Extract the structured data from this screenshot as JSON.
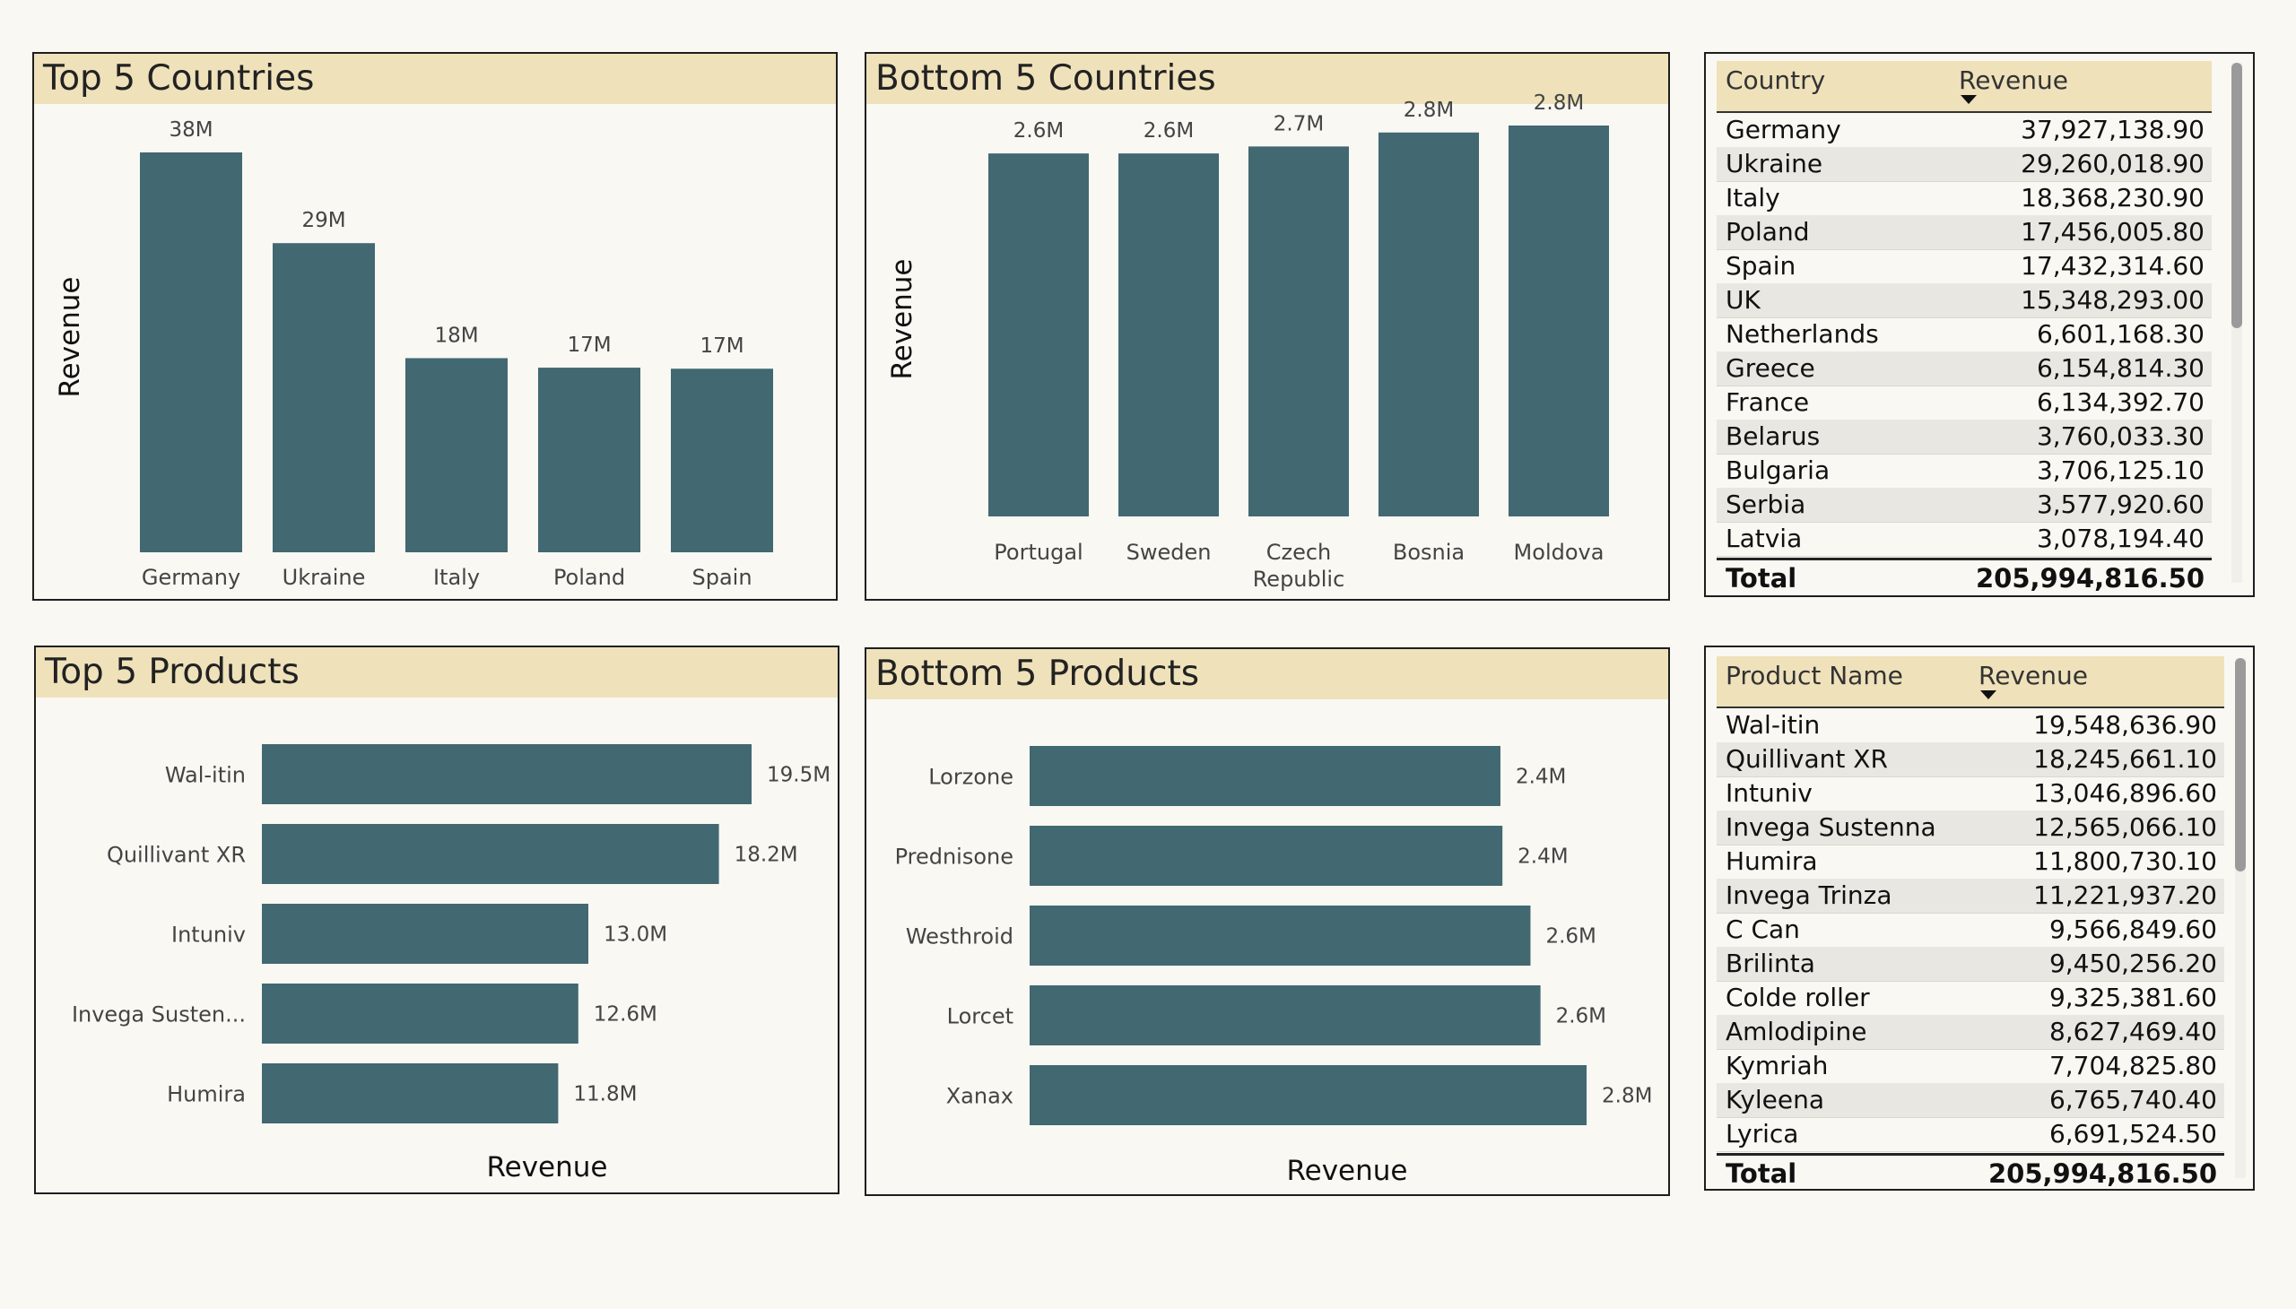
{
  "colors": {
    "bar": "#426872",
    "header_bg": "#efe1ba",
    "background": "#f9f8f3",
    "row_alt": "#e8e7e2"
  },
  "panels": {
    "top_countries_title": "Top 5 Countries",
    "bottom_countries_title": "Bottom 5 Countries",
    "top_products_title": "Top 5 Products",
    "bottom_products_title": "Bottom 5 Products"
  },
  "chart_data": [
    {
      "id": "top_countries",
      "type": "bar",
      "orientation": "vertical",
      "title": "Top 5 Countries",
      "ylabel": "Revenue",
      "xlabel": "",
      "categories": [
        "Germany",
        "Ukraine",
        "Italy",
        "Poland",
        "Spain"
      ],
      "values": [
        37.9,
        29.3,
        18.4,
        17.5,
        17.4
      ],
      "data_labels": [
        "38M",
        "29M",
        "18M",
        "17M",
        "17M"
      ],
      "units": "M",
      "ylim": [
        0,
        40
      ],
      "grid": false
    },
    {
      "id": "bottom_countries",
      "type": "bar",
      "orientation": "vertical",
      "title": "Bottom 5 Countries",
      "ylabel": "Revenue",
      "xlabel": "",
      "categories": [
        "Portugal",
        "Sweden",
        "Czech Republic",
        "Bosnia",
        "Moldova"
      ],
      "values": [
        2.6,
        2.6,
        2.65,
        2.75,
        2.8
      ],
      "data_labels": [
        "2.6M",
        "2.6M",
        "2.7M",
        "2.8M",
        "2.8M"
      ],
      "units": "M",
      "ylim": [
        0,
        3.0
      ],
      "grid": false
    },
    {
      "id": "top_products",
      "type": "bar",
      "orientation": "horizontal",
      "title": "Top 5 Products",
      "xlabel": "Revenue",
      "ylabel": "",
      "categories": [
        "Wal-itin",
        "Quillivant XR",
        "Intuniv",
        "Invega Susten...",
        "Humira"
      ],
      "values": [
        19.5,
        18.2,
        13.0,
        12.6,
        11.8
      ],
      "data_labels": [
        "19.5M",
        "18.2M",
        "13.0M",
        "12.6M",
        "11.8M"
      ],
      "units": "M",
      "xlim": [
        0,
        19.5
      ],
      "grid": false
    },
    {
      "id": "bottom_products",
      "type": "bar",
      "orientation": "horizontal",
      "title": "Bottom 5 Products",
      "xlabel": "Revenue",
      "ylabel": "",
      "categories": [
        "Lorzone",
        "Prednisone",
        "Westhroid",
        "Lorcet",
        "Xanax"
      ],
      "values": [
        2.35,
        2.36,
        2.5,
        2.55,
        2.78
      ],
      "data_labels": [
        "2.4M",
        "2.4M",
        "2.6M",
        "2.6M",
        "2.8M"
      ],
      "units": "M",
      "xlim": [
        0,
        2.78
      ],
      "grid": false
    }
  ],
  "country_table": {
    "headers": [
      "Country",
      "Revenue"
    ],
    "rows": [
      [
        "Germany",
        "37,927,138.90"
      ],
      [
        "Ukraine",
        "29,260,018.90"
      ],
      [
        "Italy",
        "18,368,230.90"
      ],
      [
        "Poland",
        "17,456,005.80"
      ],
      [
        "Spain",
        "17,432,314.60"
      ],
      [
        "UK",
        "15,348,293.00"
      ],
      [
        "Netherlands",
        "6,601,168.30"
      ],
      [
        "Greece",
        "6,154,814.30"
      ],
      [
        "France",
        "6,134,392.70"
      ],
      [
        "Belarus",
        "3,760,033.30"
      ],
      [
        "Bulgaria",
        "3,706,125.10"
      ],
      [
        "Serbia",
        "3,577,920.60"
      ],
      [
        "Latvia",
        "3,078,194.40"
      ]
    ],
    "total_label": "Total",
    "total_value": "205,994,816.50"
  },
  "product_table": {
    "headers": [
      "Product Name",
      "Revenue"
    ],
    "rows": [
      [
        "Wal-itin",
        "19,548,636.90"
      ],
      [
        "Quillivant XR",
        "18,245,661.10"
      ],
      [
        "Intuniv",
        "13,046,896.60"
      ],
      [
        "Invega Sustenna",
        "12,565,066.10"
      ],
      [
        "Humira",
        "11,800,730.10"
      ],
      [
        "Invega Trinza",
        "11,221,937.20"
      ],
      [
        "C Can",
        "9,566,849.60"
      ],
      [
        "Brilinta",
        "9,450,256.20"
      ],
      [
        "Colde roller",
        "9,325,381.60"
      ],
      [
        "Amlodipine",
        "8,627,469.40"
      ],
      [
        "Kymriah",
        "7,704,825.80"
      ],
      [
        "Kyleena",
        "6,765,740.40"
      ],
      [
        "Lyrica",
        "6,691,524.50"
      ]
    ],
    "total_label": "Total",
    "total_value": "205,994,816.50"
  }
}
